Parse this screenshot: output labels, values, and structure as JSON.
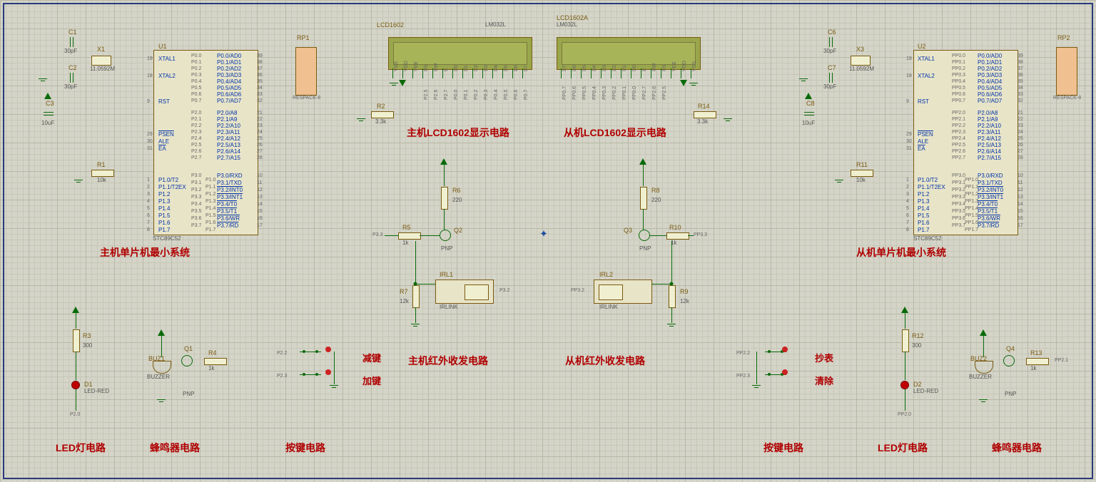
{
  "lcds": {
    "left": {
      "ref": "LCD1602",
      "part": "LM032L"
    },
    "right": {
      "ref": "LCD1602A",
      "part": "LM032L"
    }
  },
  "captions": {
    "mcu_left": "主机单片机最小系统",
    "mcu_right": "从机单片机最小系统",
    "lcd_left": "主机LCD1602显示电路",
    "lcd_right": "从机LCD1602显示电路",
    "ir_left": "主机红外收发电路",
    "ir_right": "从机红外收发电路",
    "led_left": "LED灯电路",
    "buzz_left": "蜂鸣器电路",
    "btn_left": "按键电路",
    "btn_right": "按键电路",
    "led_right": "LED灯电路",
    "buzz_right": "蜂鸣器电路",
    "key_dec": "减键",
    "key_inc": "加键",
    "key_read": "抄表",
    "key_clear": "清除"
  },
  "chips": {
    "u1": {
      "ref": "U1",
      "part": "STC89C52"
    },
    "u2": {
      "ref": "U2",
      "part": "STC89C52"
    },
    "rp1": {
      "ref": "RP1",
      "part": "RESPACK-8"
    },
    "rp2": {
      "ref": "RP2",
      "part": "RESPACK-8"
    }
  },
  "components": {
    "c1": {
      "ref": "C1",
      "val": "30pF"
    },
    "c2": {
      "ref": "C2",
      "val": "30pF"
    },
    "c3": {
      "ref": "C3",
      "val": "10uF"
    },
    "c6": {
      "ref": "C6",
      "val": "30pF"
    },
    "c7": {
      "ref": "C7",
      "val": "30pF"
    },
    "c8": {
      "ref": "C8",
      "val": "10uF"
    },
    "x1": {
      "ref": "X1",
      "val": "11.0592M"
    },
    "x3": {
      "ref": "X3",
      "val": "11.0592M"
    },
    "r1": {
      "ref": "R1",
      "val": "10k"
    },
    "r2": {
      "ref": "R2",
      "val": "3.3k"
    },
    "r3": {
      "ref": "R3",
      "val": "300"
    },
    "r4": {
      "ref": "R4",
      "val": "1k"
    },
    "r5": {
      "ref": "R5",
      "val": "1k"
    },
    "r6": {
      "ref": "R6",
      "val": "220"
    },
    "r7": {
      "ref": "R7",
      "val": "12k"
    },
    "r8": {
      "ref": "R8",
      "val": "220"
    },
    "r9": {
      "ref": "R9",
      "val": "12k"
    },
    "r10": {
      "ref": "R10",
      "val": "1k"
    },
    "r11": {
      "ref": "R11",
      "val": "10k"
    },
    "r12": {
      "ref": "R12",
      "val": "300"
    },
    "r13": {
      "ref": "R13",
      "val": "1k"
    },
    "r14": {
      "ref": "R14",
      "val": "3.3k"
    },
    "q1": {
      "ref": "Q1",
      "val": "PNP"
    },
    "q2": {
      "ref": "Q2",
      "val": "PNP"
    },
    "q3": {
      "ref": "Q3",
      "val": "PNP"
    },
    "q4": {
      "ref": "Q4",
      "val": "PNP"
    },
    "d1": {
      "ref": "D1",
      "val": "LED-RED"
    },
    "d2": {
      "ref": "D2",
      "val": "LED-RED"
    },
    "buz1": {
      "ref": "BUZ1",
      "val": "BUZZER"
    },
    "buz2": {
      "ref": "BUZ2",
      "val": "BUZZER"
    },
    "irl1": {
      "ref": "IRL1",
      "val": "IRLINK"
    },
    "irl2": {
      "ref": "IRL2",
      "val": "IRLINK"
    }
  },
  "pins_u_left": [
    "XTAL1",
    "XTAL2",
    "RST",
    "PSEN",
    "ALE",
    "EA"
  ],
  "pins_u_p0": [
    "P0.0/AD0",
    "P0.1/AD1",
    "P0.2/AD2",
    "P0.3/AD3",
    "P0.4/AD4",
    "P0.5/AD5",
    "P0.6/AD6",
    "P0.7/AD7"
  ],
  "pins_u_p2": [
    "P2.0/A8",
    "P2.1/A9",
    "P2.2/A10",
    "P2.3/A11",
    "P2.4/A12",
    "P2.5/A13",
    "P2.6/A14",
    "P2.7/A15"
  ],
  "pins_u_p3": [
    "P3.0/RXD",
    "P3.1/TXD",
    "P3.2/INT0",
    "P3.3/INT1",
    "P3.4/T0",
    "P3.5/T1",
    "P3.6/WR",
    "P3.7/RD"
  ],
  "pins_u_p1": [
    "P1.0/T2",
    "P1.1/T2EX",
    "P1.2",
    "P1.3",
    "P1.4",
    "P1.5",
    "P1.6",
    "P1.7"
  ],
  "pin_nums_left": {
    "xtal1": "19",
    "xtal2": "18",
    "rst": "9",
    "psen": "29",
    "ale": "30",
    "ea": "31"
  },
  "pin_nums_p0": [
    "39",
    "38",
    "37",
    "36",
    "35",
    "34",
    "33",
    "32"
  ],
  "pin_nums_p2": [
    "21",
    "22",
    "23",
    "24",
    "25",
    "26",
    "27",
    "28"
  ],
  "pin_nums_p3": [
    "10",
    "11",
    "12",
    "13",
    "14",
    "15",
    "16",
    "17"
  ],
  "pin_nums_p1": [
    "1",
    "2",
    "3",
    "4",
    "5",
    "6",
    "7",
    "8"
  ],
  "labels_p0_u1": [
    "P0.0",
    "P0.1",
    "P0.2",
    "P0.3",
    "P0.4",
    "P0.5",
    "P0.6",
    "P0.7"
  ],
  "labels_p2_u1": [
    "P2.0",
    "P2.1",
    "P2.2",
    "P2.3",
    "P2.4",
    "P2.5",
    "P2.6",
    "P2.7"
  ],
  "labels_p3_u1": [
    "P3.0",
    "P3.1",
    "P3.2",
    "P3.3",
    "P3.4",
    "P3.5",
    "P3.6",
    "P3.7"
  ],
  "labels_p1_u1": [
    "P1.0",
    "P1.1",
    "P1.2",
    "P1.3",
    "P1.4",
    "P1.5",
    "P1.6",
    "P1.7"
  ],
  "labels_p0_u2": [
    "PP0.0",
    "PP0.1",
    "PP0.2",
    "PP0.3",
    "PP0.4",
    "PP0.5",
    "PP0.6",
    "PP0.7"
  ],
  "labels_p2_u2": [
    "PP2.0",
    "PP2.1",
    "PP2.2",
    "PP2.3",
    "PP2.4",
    "PP2.5",
    "PP2.6",
    "PP2.7"
  ],
  "labels_p3_u2": [
    "PP3.0",
    "PP3.1",
    "PP3.2",
    "PP3.3",
    "PP3.4",
    "PP3.5",
    "PP3.6",
    "PP3.7"
  ],
  "labels_p1_u2": [
    "PP1.0",
    "PP1.1",
    "PP1.2",
    "PP1.3",
    "PP1.4",
    "PP1.5",
    "PP1.6",
    "PP1.7"
  ],
  "lcd_pins_left": [
    "VSS",
    "VDD",
    "VEE",
    "RS",
    "RW",
    "E",
    "D0",
    "D1",
    "D2",
    "D3",
    "D4",
    "D5",
    "D6",
    "D7"
  ],
  "lcd_nets_left": [
    "",
    "",
    "",
    "P2.5",
    "P2.6",
    "P2.7",
    "P0.0",
    "P0.1",
    "P0.2",
    "P0.3",
    "P0.4",
    "P0.5",
    "P0.6",
    "P0.7"
  ],
  "lcd_pins_right": [
    "D7",
    "D6",
    "D5",
    "D4",
    "D3",
    "D2",
    "D1",
    "D0",
    "E",
    "RW",
    "RS",
    "VEE",
    "VDD",
    "VSS"
  ],
  "lcd_nets_right": [
    "PP0.7",
    "PP0.6",
    "PP0.5",
    "PP0.4",
    "PP0.3",
    "PP0.2",
    "PP0.1",
    "PP0.0",
    "PP2.7",
    "PP2.6",
    "PP2.5",
    "",
    "",
    ""
  ],
  "buttons": {
    "left": [
      {
        "net": "P2.2"
      },
      {
        "net": "P2.3"
      }
    ],
    "right": [
      {
        "net": "PP2.2"
      },
      {
        "net": "PP2.3"
      }
    ]
  },
  "ir_nets": {
    "tx_left": "P3.3",
    "rx_left": "P3.2",
    "tx_right": "PP3.3",
    "rx_right": "PP3.2"
  },
  "misc": {
    "p20": "P2.0",
    "pp20": "PP2.0",
    "pp21": "PP2.1"
  }
}
